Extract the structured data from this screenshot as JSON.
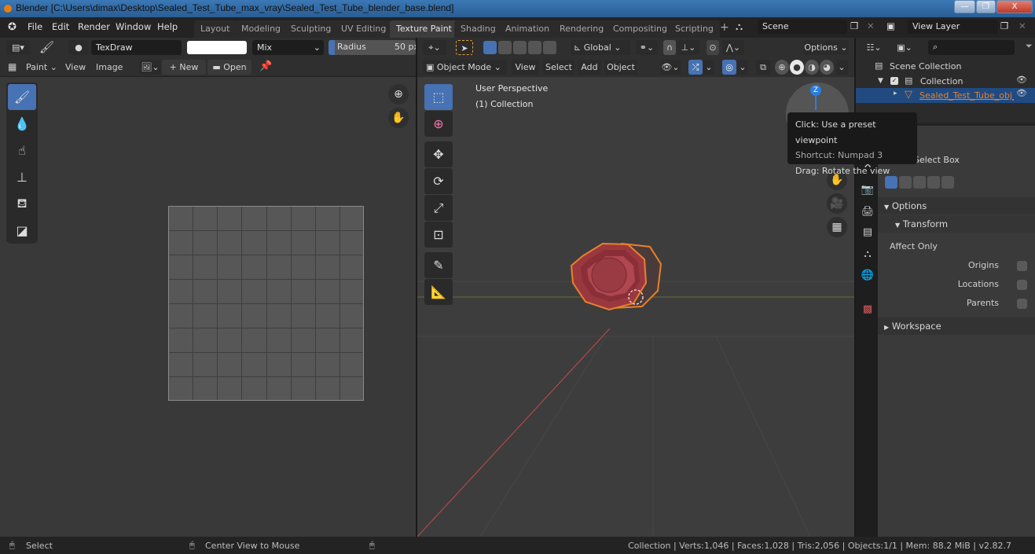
{
  "window": {
    "title": "Blender [C:\\Users\\dimax\\Desktop\\Sealed_Test_Tube_max_vray\\Sealed_Test_Tube_blender_base.blend]",
    "controls": {
      "minimize": "—",
      "maximize": "❐",
      "close": "X"
    }
  },
  "menubar": {
    "items": [
      "File",
      "Edit",
      "Render",
      "Window",
      "Help"
    ],
    "workspaces": [
      {
        "label": "Layout",
        "active": false
      },
      {
        "label": "Modeling",
        "active": false
      },
      {
        "label": "Sculpting",
        "active": false
      },
      {
        "label": "UV Editing",
        "active": false
      },
      {
        "label": "Texture Paint",
        "active": true
      },
      {
        "label": "Shading",
        "active": false
      },
      {
        "label": "Animation",
        "active": false
      },
      {
        "label": "Rendering",
        "active": false
      },
      {
        "label": "Compositing",
        "active": false
      },
      {
        "label": "Scripting",
        "active": false
      }
    ],
    "add_workspace": "+",
    "scene": "Scene",
    "view_layer": "View Layer"
  },
  "image_editor": {
    "brush_name": "TexDraw",
    "blend_mode": "Mix",
    "radius_label": "Radius",
    "radius_value": "50 px",
    "mode_label": "Paint",
    "menus": [
      "View",
      "Image"
    ],
    "new_label": "New",
    "open_label": "Open",
    "tools": [
      "draw-brush",
      "soften",
      "smear",
      "clone",
      "fill",
      "mask"
    ],
    "grid_divisions": 8
  },
  "viewport": {
    "transform_orientation": "Global",
    "options_label": "Options",
    "mode": "Object Mode",
    "menus": [
      "View",
      "Select",
      "Add",
      "Object"
    ],
    "overlay_title": "User Perspective",
    "overlay_subtitle": "(1) Collection",
    "gizmo_axis": "Z",
    "tools": [
      "select-box",
      "cursor",
      "move",
      "rotate",
      "scale",
      "transform",
      "annotate",
      "measure"
    ]
  },
  "tooltip": {
    "lines": [
      "Click: Use a preset viewpoint",
      "Shortcut: Numpad 3",
      "Drag: Rotate the view"
    ]
  },
  "outliner": {
    "search_placeholder": "",
    "scene_collection": "Scene Collection",
    "collection": "Collection",
    "object": "Sealed_Test_Tube_obj_ba"
  },
  "properties": {
    "tool_name": "Select Box",
    "options_label": "Options",
    "transform_label": "Transform",
    "affect_only_label": "Affect Only",
    "checkboxes": [
      {
        "label": "Origins",
        "checked": false
      },
      {
        "label": "Locations",
        "checked": false
      },
      {
        "label": "Parents",
        "checked": false
      }
    ],
    "workspace_label": "Workspace"
  },
  "statusbar": {
    "left_action": "Select",
    "middle_action": "Center View to Mouse",
    "stats": "Collection | Verts:1,046 | Faces:1,028 | Tris:2,056 | Objects:1/1 | Mem: 88.2 MiB | v2.82.7"
  },
  "colors": {
    "accent_blue": "#4772b3",
    "selection_orange": "#e8812a",
    "object_red": "#a8393f"
  }
}
